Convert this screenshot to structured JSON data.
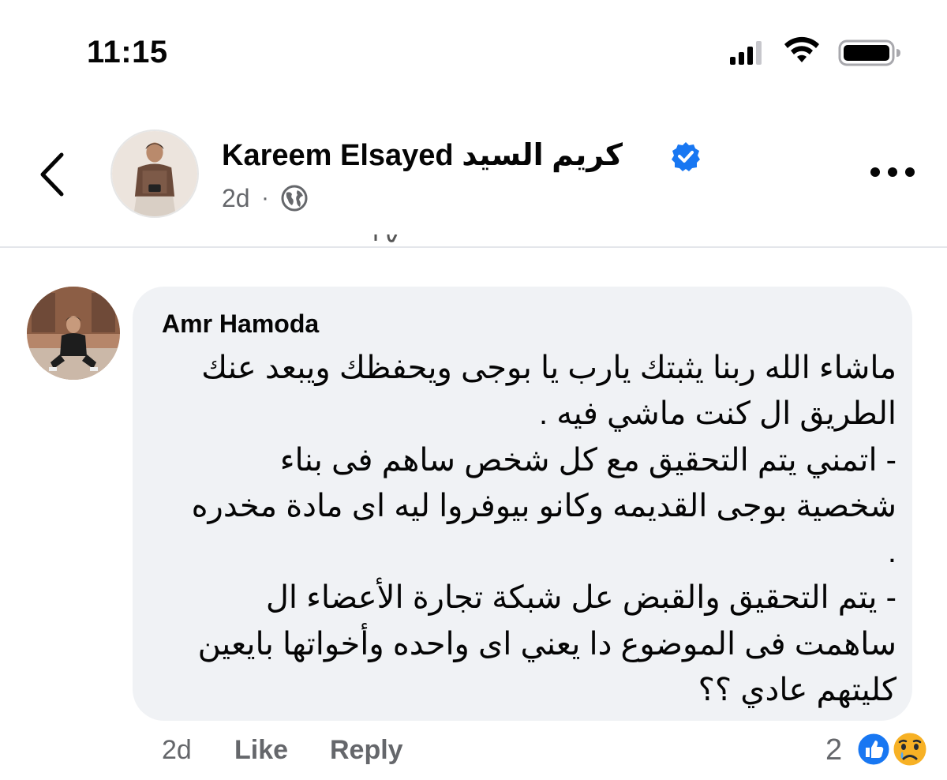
{
  "status_bar": {
    "time": "11:15",
    "icons": [
      "cellular-signal-icon",
      "wifi-icon",
      "battery-icon"
    ]
  },
  "post": {
    "author_name": "Kareem Elsayed كريم  السيد",
    "verified": true,
    "time": "2d",
    "separator": "·",
    "audience_icon": "globe-icon"
  },
  "comment": {
    "author_name": "Amr Hamoda",
    "lines": [
      "ماشاء الله ربنا يثبتك يارب يا بوجى ويحفظك ويبعد عنك",
      "الطريق ال كنت ماشي فيه .",
      "- اتمني يتم التحقيق مع كل شخص ساهم فى بناء",
      "شخصية بوجى القديمه وكانو بيوفروا ليه اى مادة مخدره",
      ".",
      "- يتم التحقيق والقبض عل  شبكة تجارة الأعضاء ال",
      "ساهمت فى الموضوع دا يعني اى واحده وأخواتها بايعين",
      "كليتهم عادي ؟؟"
    ],
    "time": "2d",
    "like_label": "Like",
    "reply_label": "Reply",
    "reaction_count": "2",
    "reactions": [
      "like-reaction-icon",
      "sad-reaction-icon"
    ]
  },
  "colors": {
    "bubble_bg": "#f0f2f5",
    "secondary_text": "#65676b",
    "facebook_blue": "#1877f2",
    "sad_yellow": "#f7b125"
  }
}
